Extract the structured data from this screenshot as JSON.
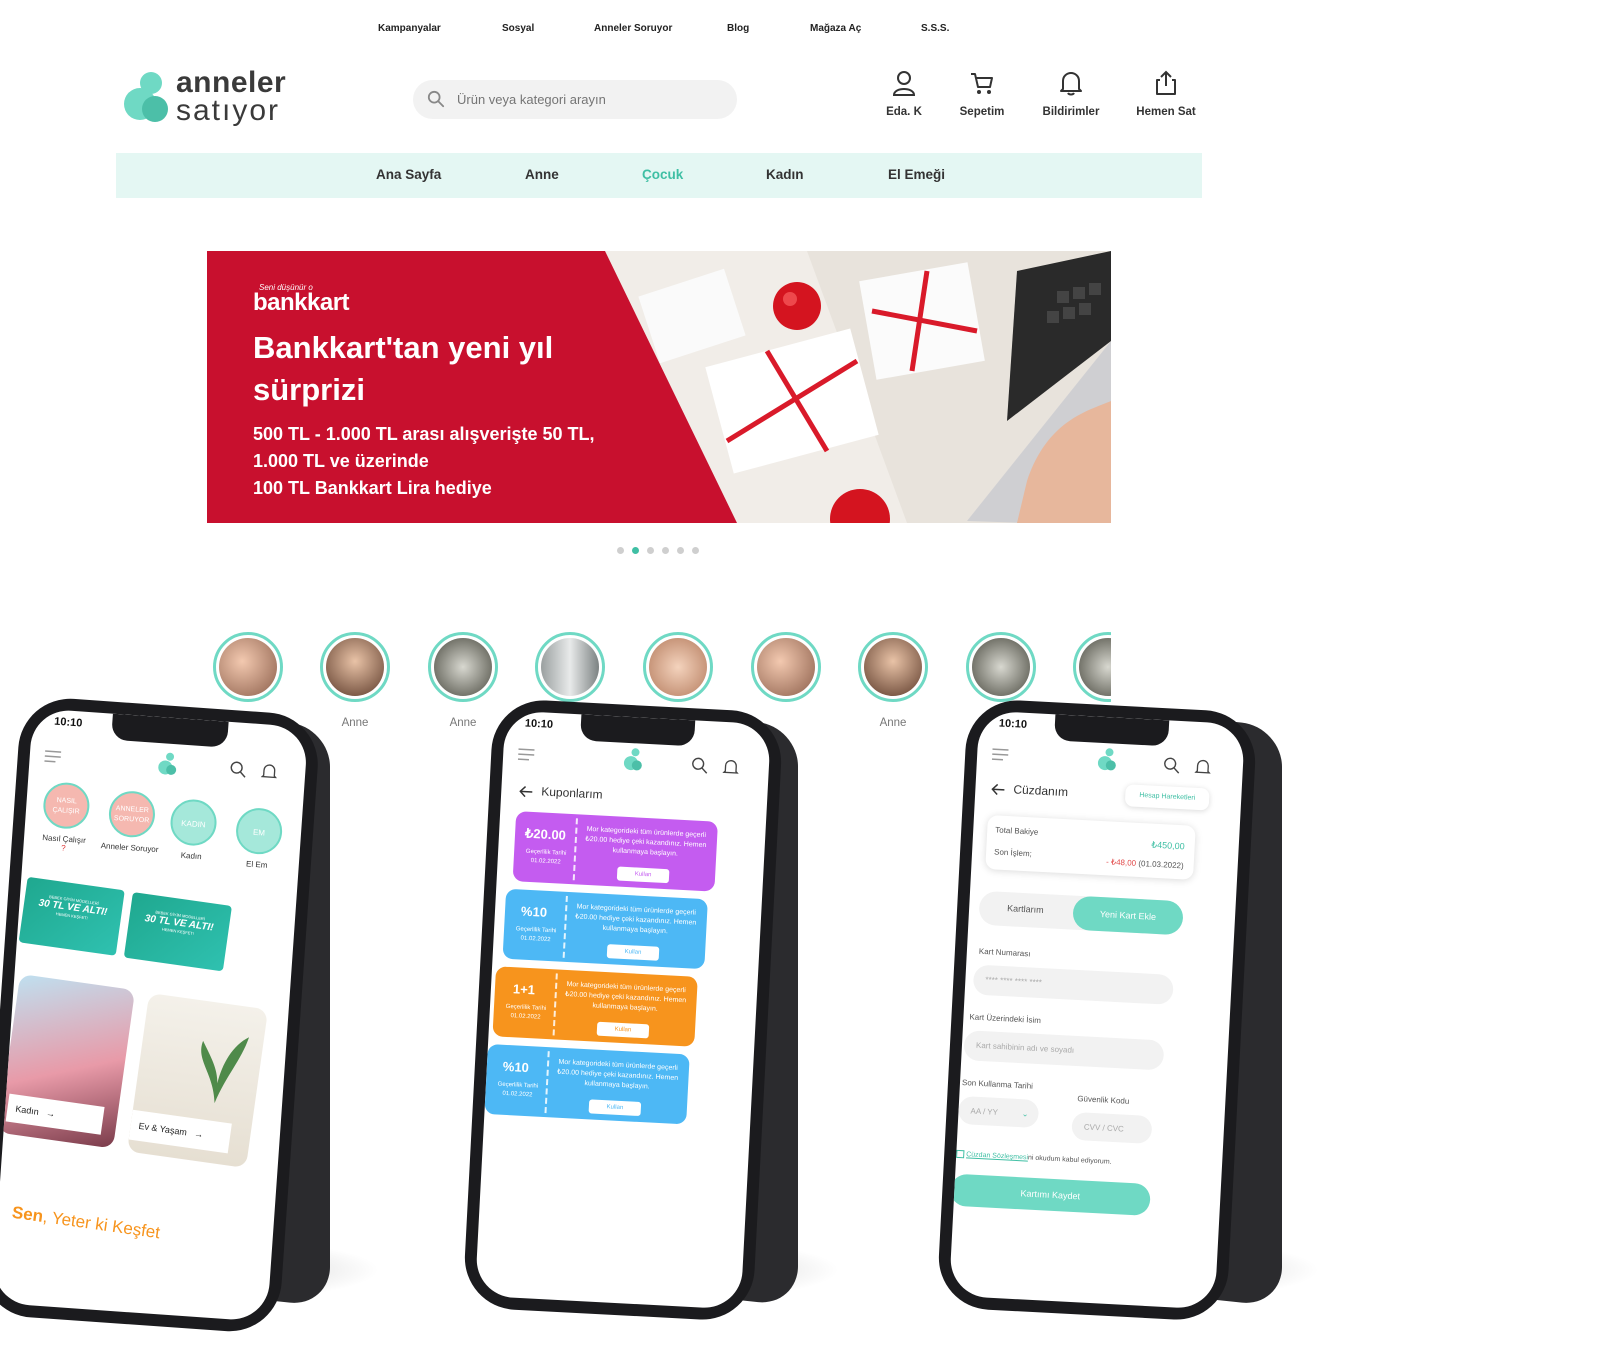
{
  "top_links": [
    "Kampanyalar",
    "Sosyal",
    "Anneler Soruyor",
    "Blog",
    "Mağaza Aç",
    "S.S.S."
  ],
  "logo": {
    "line1": "anneler",
    "line2": "satıyor"
  },
  "search": {
    "placeholder": "Ürün veya kategori arayın"
  },
  "header_actions": [
    {
      "label": "Eda. K",
      "icon": "user-icon"
    },
    {
      "label": "Sepetim",
      "icon": "cart-icon"
    },
    {
      "label": "Bildirimler",
      "icon": "bell-icon"
    },
    {
      "label": "Hemen Sat",
      "icon": "share-icon"
    }
  ],
  "nav": {
    "items": [
      "Ana Sayfa",
      "Anne",
      "Çocuk",
      "Kadın",
      "El Emeği"
    ],
    "active": "Çocuk"
  },
  "banner": {
    "tagline": "Seni düşünür o",
    "brand": "bankkart",
    "headline": "Bankkart'tan yeni yıl sürprizi",
    "body_line1": "500 TL - 1.000 TL arası alışverişte 50 TL,",
    "body_line2": "1.000 TL ve üzerinde",
    "body_line3": "100 TL Bankkart Lira hediye",
    "slides": 6,
    "active_slide": 2
  },
  "stories": [
    {
      "label": ""
    },
    {
      "label": "Anne"
    },
    {
      "label": "Anne"
    },
    {
      "label": ""
    },
    {
      "label": ""
    },
    {
      "label": ""
    },
    {
      "label": "Anne"
    },
    {
      "label": ""
    },
    {
      "label": ""
    }
  ],
  "phone1": {
    "time": "10:10",
    "categories": [
      {
        "label": "Nasıl Çalışır",
        "badge": "NASIL ÇALIŞIR",
        "sub": "?"
      },
      {
        "label": "Anneler Soruyor",
        "badge": "ANNELER SORUYOR",
        "sub": ""
      },
      {
        "label": "Kadın",
        "badge": "KADIN",
        "sub": ""
      },
      {
        "label": "El Em",
        "badge": "EM",
        "sub": ""
      }
    ],
    "promo": {
      "small": "BEBEK GİYİM MODELLERİ",
      "big": "30 TL VE ALTI!",
      "cta": "HEMEN KEŞFET!"
    },
    "tiles": [
      {
        "label": "Kadın"
      },
      {
        "label": "Ev & Yaşam"
      }
    ],
    "slogan_bold": "Sen",
    "slogan_rest": ", Yeter ki Keşfet"
  },
  "phone2": {
    "time": "10:10",
    "title": "Kuponlarım",
    "coupons": [
      {
        "amount": "₺20.00",
        "valid_label": "Geçerlilik Tarihi",
        "valid": "01.02.2022",
        "desc": "Mor kategorideki tüm ürünlerde geçerli ₺20.00 hediye çeki kazandınız. Hemen kullanmaya başlayın.",
        "button": "Kullan",
        "color": "#c45cf0"
      },
      {
        "amount": "%10",
        "valid_label": "Geçerlilik Tarihi",
        "valid": "01.02.2022",
        "desc": "Mor kategorideki tüm ürünlerde geçerli ₺20.00 hediye çeki kazandınız. Hemen kullanmaya başlayın.",
        "button": "Kullan",
        "color": "#4db8f5"
      },
      {
        "amount": "1+1",
        "valid_label": "Geçerlilik Tarihi",
        "valid": "01.02.2022",
        "desc": "Mor kategorideki tüm ürünlerde geçerli ₺20.00 hediye çeki kazandınız. Hemen kullanmaya başlayın.",
        "button": "Kullan",
        "color": "#f7941d"
      },
      {
        "amount": "%10",
        "valid_label": "Geçerlilik Tarihi",
        "valid": "01.02.2022",
        "desc": "Mor kategorideki tüm ürünlerde geçerli ₺20.00 hediye çeki kazandınız. Hemen kullanmaya başlayın.",
        "button": "Kullan",
        "color": "#4db8f5"
      }
    ]
  },
  "phone3": {
    "time": "10:10",
    "title": "Cüzdanım",
    "history_button": "Hesap Hareketleri",
    "balance_label": "Total Bakiye",
    "balance_value": "₺450,00",
    "last_label": "Son İşlem;",
    "last_value": "- ₺48,00",
    "last_date": "(01.03.2022)",
    "tab_cards": "Kartlarım",
    "tab_add": "Yeni Kart Ekle",
    "card_number_label": "Kart Numarası",
    "card_number_placeholder": "****  ****  ****  ****",
    "card_name_label": "Kart Üzerindeki İsim",
    "card_name_placeholder": "Kart sahibinin adı ve soyadı",
    "expiry_label": "Son Kullanma Tarihi",
    "expiry_placeholder": "AA / YY",
    "cvv_label": "Güvenlik Kodu",
    "cvv_placeholder": "CVV / CVC",
    "terms_link": "Cüzdan Sözleşmesi",
    "terms_rest": "ni okudum kabul ediyorum.",
    "save_button": "Kartımı Kaydet"
  },
  "colors": {
    "accent": "#3fbfa4",
    "accent_light": "#6fd9c4",
    "nav_bg": "#e4f7f3",
    "banner_red": "#c8102e",
    "slogan_orange": "#f7941d"
  }
}
